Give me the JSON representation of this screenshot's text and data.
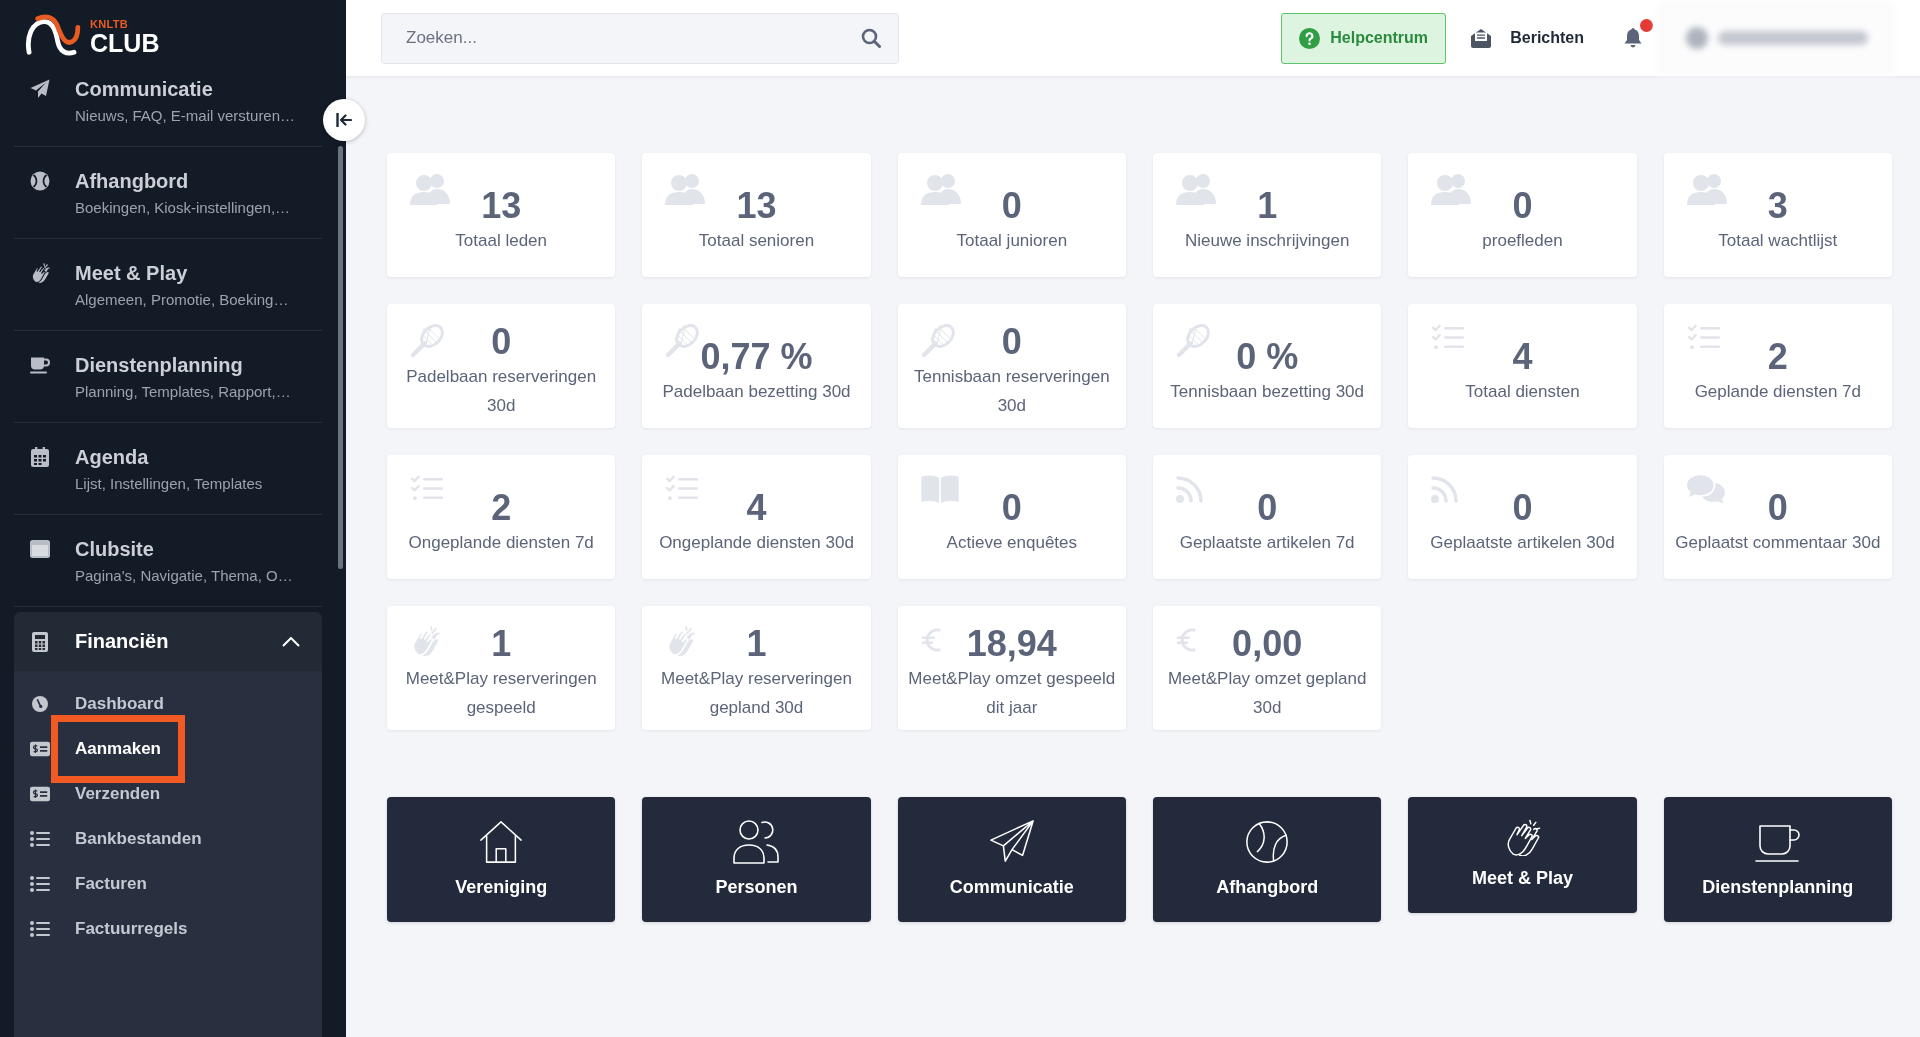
{
  "sidebar": {
    "logo": {
      "overline": "KNLTB",
      "wordmark": "CLUB"
    },
    "items": [
      {
        "kind": "link",
        "title": "Communicatie",
        "subtitle": "Nieuws, FAQ, E-mail versturen…"
      },
      {
        "kind": "link",
        "title": "Afhangbord",
        "subtitle": "Boekingen, Kiosk-instellingen,…"
      },
      {
        "kind": "link",
        "title": "Meet & Play",
        "subtitle": "Algemeen, Promotie, Boeking…"
      },
      {
        "kind": "link",
        "title": "Dienstenplanning",
        "subtitle": "Planning, Templates, Rapport,…"
      },
      {
        "kind": "link",
        "title": "Agenda",
        "subtitle": "Lijst, Instellingen, Templates"
      },
      {
        "kind": "link",
        "title": "Clubsite",
        "subtitle": "Pagina's, Navigatie, Thema, O…"
      },
      {
        "kind": "group",
        "title": "Financiën",
        "expanded": true,
        "children": [
          {
            "label": "Dashboard",
            "selected": false,
            "highlighted": false
          },
          {
            "label": "Aanmaken",
            "selected": true,
            "highlighted": true
          },
          {
            "label": "Verzenden",
            "selected": false,
            "highlighted": false
          },
          {
            "label": "Bankbestanden",
            "selected": false,
            "highlighted": false
          },
          {
            "label": "Facturen",
            "selected": false,
            "highlighted": false
          },
          {
            "label": "Factuurregels",
            "selected": false,
            "highlighted": false
          }
        ]
      }
    ]
  },
  "search": {
    "placeholder": "Zoeken..."
  },
  "help_button": {
    "label": "Helpcentrum"
  },
  "messages_link": {
    "label": "Berichten"
  },
  "notifications": {
    "unread": true
  },
  "stats": [
    {
      "value": "13",
      "label": "Totaal leden"
    },
    {
      "value": "13",
      "label": "Totaal senioren"
    },
    {
      "value": "0",
      "label": "Totaal junioren"
    },
    {
      "value": "1",
      "label": "Nieuwe inschrijvingen"
    },
    {
      "value": "0",
      "label": "proefleden"
    },
    {
      "value": "3",
      "label": "Totaal wachtlijst"
    },
    {
      "value": "0",
      "label": "Padelbaan reserveringen 30d"
    },
    {
      "value": "0,77 %",
      "label": "Padelbaan bezetting 30d"
    },
    {
      "value": "0",
      "label": "Tennisbaan reserveringen 30d"
    },
    {
      "value": "0 %",
      "label": "Tennisbaan bezetting 30d"
    },
    {
      "value": "4",
      "label": "Totaal diensten"
    },
    {
      "value": "2",
      "label": "Geplande diensten 7d"
    },
    {
      "value": "2",
      "label": "Ongeplande diensten 7d"
    },
    {
      "value": "4",
      "label": "Ongeplande diensten 30d"
    },
    {
      "value": "0",
      "label": "Actieve enquêtes"
    },
    {
      "value": "0",
      "label": "Geplaatste artikelen 7d"
    },
    {
      "value": "0",
      "label": "Geplaatste artikelen 30d"
    },
    {
      "value": "0",
      "label": "Geplaatst commentaar 30d"
    },
    {
      "value": "1",
      "label": "Meet&Play reserveringen gespeeld"
    },
    {
      "value": "1",
      "label": "Meet&Play reserveringen gepland 30d"
    },
    {
      "value": "18,94",
      "label": "Meet&Play omzet gespeeld dit jaar"
    },
    {
      "value": "0,00",
      "label": "Meet&Play omzet gepland 30d"
    }
  ],
  "shortcuts": [
    {
      "label": "Vereniging"
    },
    {
      "label": "Personen"
    },
    {
      "label": "Communicatie"
    },
    {
      "label": "Afhangbord"
    },
    {
      "label": "Meet & Play"
    },
    {
      "label": "Dienstenplanning"
    }
  ]
}
